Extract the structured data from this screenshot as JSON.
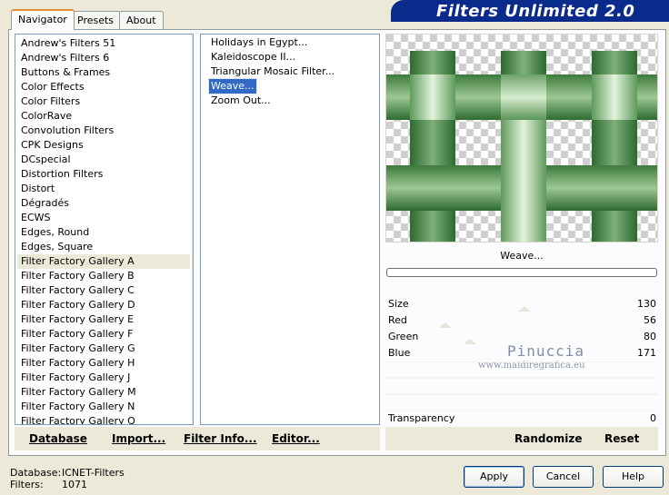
{
  "tabs": [
    {
      "label": "Navigator",
      "active": true
    },
    {
      "label": "Presets",
      "active": false
    },
    {
      "label": "About",
      "active": false
    }
  ],
  "banner_title": "Filters Unlimited 2.0",
  "categories": [
    "Andrew's Filters 51",
    "Andrew's Filters 6",
    "Buttons & Frames",
    "Color Effects",
    "Color Filters",
    "ColorRave",
    "Convolution Filters",
    "CPK Designs",
    "DCspecial",
    "Distortion Filters",
    "Distort",
    "Dégradés",
    "ECWS",
    "Edges, Round",
    "Edges, Square",
    "Filter Factory Gallery A",
    "Filter Factory Gallery B",
    "Filter Factory Gallery C",
    "Filter Factory Gallery D",
    "Filter Factory Gallery E",
    "Filter Factory Gallery F",
    "Filter Factory Gallery G",
    "Filter Factory Gallery H",
    "Filter Factory Gallery J",
    "Filter Factory Gallery M",
    "Filter Factory Gallery N",
    "Filter Factory Gallery Q"
  ],
  "selected_category_index": 15,
  "filters": [
    "Holidays in Egypt...",
    "Kaleidoscope II...",
    "Triangular Mosaic Filter...",
    "Weave...",
    "Zoom Out..."
  ],
  "selected_filter_index": 3,
  "filter_name": "Weave...",
  "params": [
    {
      "label": "Size",
      "value": "130",
      "slider": 0.51
    },
    {
      "label": "Red",
      "value": "56",
      "slider": 0.22
    },
    {
      "label": "Green",
      "value": "80",
      "slider": 0.31
    },
    {
      "label": "Blue",
      "value": "171",
      "slider": null
    }
  ],
  "transparency": {
    "label": "Transparency",
    "value": "0"
  },
  "watermark": {
    "line1": "Pinuccia",
    "line2": "www.maidiregrafica.eu"
  },
  "bottom_links": {
    "database": "Database",
    "import": "Import...",
    "filter_info": "Filter Info...",
    "editor": "Editor..."
  },
  "preview_buttons": {
    "randomize": "Randomize",
    "reset": "Reset"
  },
  "status": {
    "database_label": "Database:",
    "database_value": "ICNET-Filters",
    "filters_label": "Filters:",
    "filters_value": "1071"
  },
  "dialog_buttons": {
    "apply": "Apply",
    "cancel": "Cancel",
    "help": "Help"
  },
  "colors": {
    "weave_dark": "#2e6a2e",
    "weave_light": "#c8e6c0",
    "selection": "#316ac5",
    "banner": "#0a2a8c"
  }
}
